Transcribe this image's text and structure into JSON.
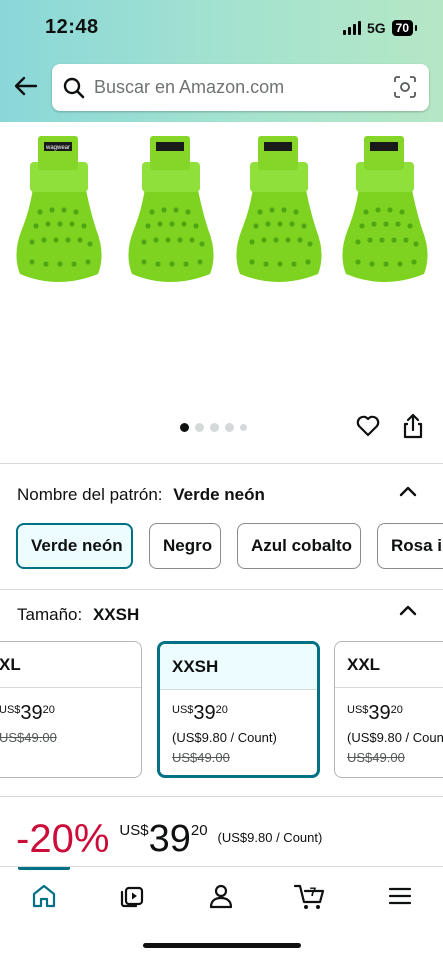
{
  "status_bar": {
    "time": "12:48",
    "network": "5G",
    "battery": "70"
  },
  "search": {
    "placeholder": "Buscar en Amazon.com"
  },
  "gallery": {
    "brand_print": "wagwear",
    "dots_total": 5,
    "active_dot": 0
  },
  "pattern": {
    "label": "Nombre del patrón:",
    "selected_value": "Verde neón",
    "options": [
      "Verde neón",
      "Negro",
      "Azul cobalto",
      "Rosa in"
    ]
  },
  "size": {
    "label": "Tamaño:",
    "selected_value": "XXSH",
    "cards": [
      {
        "name": "XL",
        "currency": "US$",
        "whole": "39",
        "cents": "20",
        "unit_price": "",
        "was": "US$49.00"
      },
      {
        "name": "XXSH",
        "currency": "US$",
        "whole": "39",
        "cents": "20",
        "unit_price": "(US$9.80 / Count)",
        "was": "US$49.00"
      },
      {
        "name": "XXL",
        "currency": "US$",
        "whole": "39",
        "cents": "20",
        "unit_price": "(US$9.80 / Coun",
        "was": "US$49.00"
      }
    ]
  },
  "deal": {
    "discount": "-20%",
    "currency": "US$",
    "whole": "39",
    "cents": "20",
    "unit_price": "(US$9.80 / Count)"
  },
  "bottom_nav": {
    "items": [
      {
        "icon": "home-icon"
      },
      {
        "icon": "video-icon"
      },
      {
        "icon": "account-icon"
      },
      {
        "icon": "cart-icon",
        "badge": "7"
      },
      {
        "icon": "menu-icon"
      }
    ]
  },
  "colors": {
    "accent": "#007185",
    "deal_red": "#cc0c39",
    "boot_green": "#7ed321"
  }
}
